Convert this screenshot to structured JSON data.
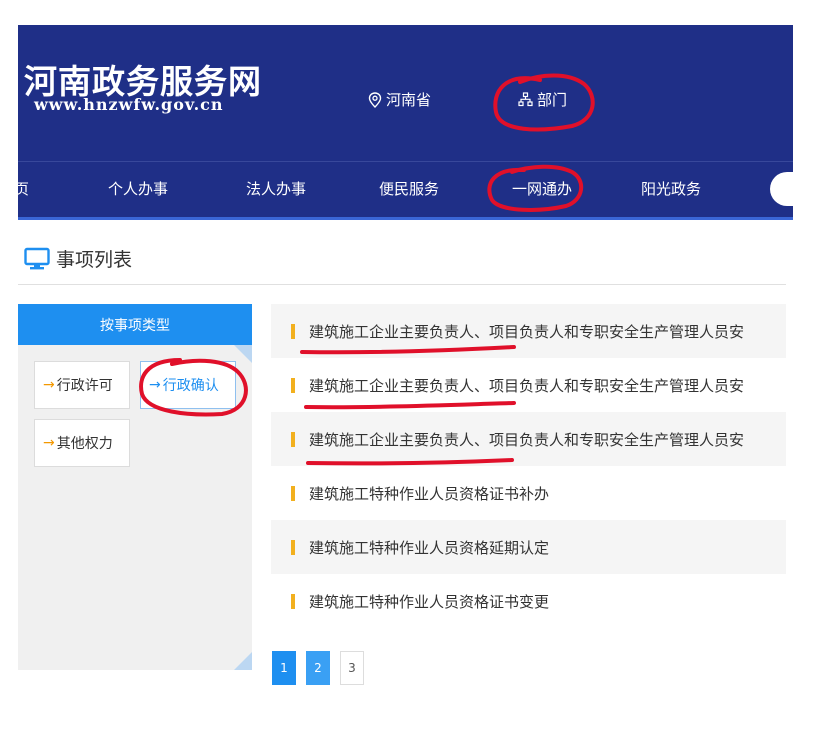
{
  "header": {
    "title": "河南政务服务网",
    "url": "www.hnzwfw.gov.cn",
    "location": "河南省",
    "department": "部门"
  },
  "nav": {
    "items": [
      "页",
      "个人办事",
      "法人办事",
      "便民服务",
      "一网通办",
      "阳光政务"
    ]
  },
  "section": {
    "title": "事项列表"
  },
  "sidebar": {
    "heading": "按事项类型",
    "types": [
      "行政许可",
      "行政确认",
      "其他权力"
    ],
    "selected": "行政确认"
  },
  "list": {
    "items": [
      "建筑施工企业主要负责人、项目负责人和专职安全生产管理人员安",
      "建筑施工企业主要负责人、项目负责人和专职安全生产管理人员安",
      "建筑施工企业主要负责人、项目负责人和专职安全生产管理人员安",
      "建筑施工特种作业人员资格证书补办",
      "建筑施工特种作业人员资格延期认定",
      "建筑施工特种作业人员资格证书变更"
    ]
  },
  "pagination": {
    "pages": [
      "1",
      "2",
      "3"
    ],
    "current": 1
  },
  "annotation": {
    "color": "#e0102a"
  },
  "colors": {
    "header_bg": "#1f2f87",
    "accent": "#1e8ff0",
    "list_marker": "#f2b01e"
  }
}
